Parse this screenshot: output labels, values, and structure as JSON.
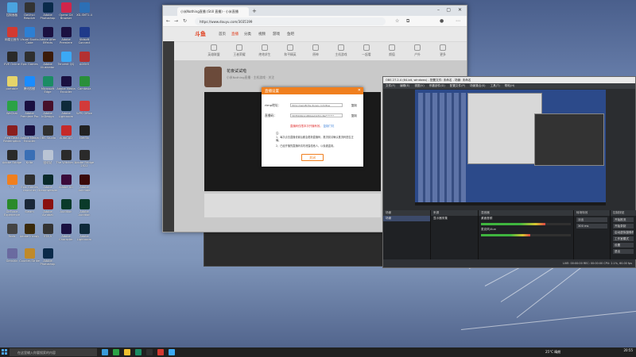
{
  "desktop": {
    "icons": [
      {
        "label": "控制面板",
        "color": "#4aa3df"
      },
      {
        "label": "DaVinci Resolve",
        "color": "#333333"
      },
      {
        "label": "Adobe Photoshop",
        "color": "#0a2a4a"
      },
      {
        "label": "Opera GX Browser",
        "color": "#d0254b"
      },
      {
        "label": "XD-SMT1.4",
        "color": "#2c6fb5"
      },
      {
        "label": "网易云音乐",
        "color": "#d33a31"
      },
      {
        "label": "Visual Studio Code",
        "color": "#2d7fd3"
      },
      {
        "label": "Adobe After Effects",
        "color": "#1a1040"
      },
      {
        "label": "Adobe Premiere",
        "color": "#1a1040"
      },
      {
        "label": "Ubisoft Connect",
        "color": "#1f3a8a"
      },
      {
        "label": "EVE Online",
        "color": "#2a2a2a"
      },
      {
        "label": "Epic Games",
        "color": "#2f2f2f"
      },
      {
        "label": "Adobe Illustrator",
        "color": "#3b1b0a"
      },
      {
        "label": "Tencent QQ",
        "color": "#3ba9f5"
      },
      {
        "label": "ADSKS",
        "color": "#b33131"
      },
      {
        "label": "portable",
        "color": "#e6d46a"
      },
      {
        "label": "腾讯视频",
        "color": "#1a8cff"
      },
      {
        "label": "Microsoft Edge",
        "color": "#1b8c64"
      },
      {
        "label": "Adobe Media Encoder",
        "color": "#1a1040"
      },
      {
        "label": "Camtasia",
        "color": "#2a8f3a"
      },
      {
        "label": "WeChat",
        "color": "#2ba245"
      },
      {
        "label": "Adobe Premiere Pro",
        "color": "#1a1040"
      },
      {
        "label": "Adobe InDesign",
        "color": "#47102a"
      },
      {
        "label": "Adobe Lightroom",
        "color": "#0e2a3a"
      },
      {
        "label": "WPS Office",
        "color": "#d23a3a"
      },
      {
        "label": "Red Dead Redemption",
        "color": "#8a1e1e"
      },
      {
        "label": "Adobe Media Encoder",
        "color": "#1a1040"
      },
      {
        "label": "OBS Studio",
        "color": "#303030"
      },
      {
        "label": "AutoCAD",
        "color": "#c52a2a"
      },
      {
        "label": "Netflix",
        "color": "#222222"
      },
      {
        "label": "Adobe Bridge",
        "color": "#2a2a2a"
      },
      {
        "label": "Krita",
        "color": "#3a6fb5"
      },
      {
        "label": "回收站",
        "color": "#b9c4d4"
      },
      {
        "label": "The Witcher 3",
        "color": "#2a2a2a"
      },
      {
        "label": "Adobe Bridge 2022",
        "color": "#2a2a2a"
      },
      {
        "label": "小米",
        "color": "#f07f1e"
      },
      {
        "label": "Epic Games Launcher",
        "color": "#2f2f2f"
      },
      {
        "label": "Adobe Dreamweaver",
        "color": "#0a2a2a"
      },
      {
        "label": "Adobe XD",
        "color": "#3a0a3a"
      },
      {
        "label": "Adobe Animate",
        "color": "#3a0a0a"
      },
      {
        "label": "GeForce Experience",
        "color": "#2a8a2a"
      },
      {
        "label": "Steam",
        "color": "#1b2838"
      },
      {
        "label": "Adobe Acrobat",
        "color": "#8a1010"
      },
      {
        "label": "Audition",
        "color": "#0a3a2a"
      },
      {
        "label": "Adobe Audition",
        "color": "#0a3a2a"
      },
      {
        "label": "Tools",
        "color": "#444444"
      },
      {
        "label": "Adobe Incopy",
        "color": "#3a2a0a"
      },
      {
        "label": "GTA V",
        "color": "#333333"
      },
      {
        "label": "Adobe Character",
        "color": "#1a1040"
      },
      {
        "label": "Adobe Lightroom Classic",
        "color": "#0e2a3a"
      },
      {
        "label": "Genshin",
        "color": "#6a6aa0"
      },
      {
        "label": "Counter-Strike",
        "color": "#c08a2a"
      },
      {
        "label": "Adobe Photoshop 2022",
        "color": "#0a2a4a"
      }
    ]
  },
  "browser": {
    "tab_title": "小米Nothing直播 (Still 直播) - 小米直播",
    "url": "https://www.douyu.com/3035199",
    "new_tab": "+",
    "site": {
      "logo": "斗鱼",
      "nav": [
        "首页",
        "直播",
        "分类",
        "视频",
        "游戏",
        "鱼吧"
      ],
      "categories": [
        "英雄联盟",
        "王者荣耀",
        "绝地求生",
        "和平精英",
        "原神",
        "主机游戏",
        "一起看",
        "颜值",
        "户外",
        "更多"
      ],
      "streamer_name": "花夜试试啦",
      "streamer_meta": "小米Nothing直播 · 主机游戏 · 关注"
    },
    "dialog": {
      "title": "直播设置",
      "rtmp_label": "rtmp地址：",
      "rtmp_value": "rtmp://sendtc3a.douyu.com/live",
      "code_label": "直播码：",
      "code_value": "3035199rgnXRKguDpTmcRe*******",
      "copy1": "复制",
      "copy2": "复制",
      "warning": "直播码仅限本次开播有效。",
      "warning_link": "复制门坑",
      "notes_title": "注：",
      "notes": [
        "1、每次点击直播设置后都会更新直播码，推流前请确认推流码是否正确。",
        "2、已经开播的直播码请勿泄露给他人，以免被盗用。"
      ],
      "close_button": "关闭"
    }
  },
  "obs": {
    "title": "OBS 27.2.4 (64-bit, windows) - 配置文件: 未命名 - 场景: 未命名",
    "menu": [
      "文件(F)",
      "编辑(E)",
      "视图(V)",
      "停靠部件(D)",
      "配置文件(P)",
      "场景集合(S)",
      "工具(T)",
      "帮助(H)"
    ],
    "docks": {
      "scenes_title": "场景",
      "scenes": [
        "场景"
      ],
      "sources_title": "来源",
      "sources": [
        "显示器采集"
      ],
      "mixer_title": "混音器",
      "mixer": [
        {
          "name": "桌面音频",
          "level": 0.72
        },
        {
          "name": "麦克风/Aux",
          "level": 0.55
        }
      ],
      "transitions_title": "转场特效",
      "transition": "淡出",
      "duration": "300 ms",
      "controls_title": "控制按钮",
      "controls": [
        "开始推流",
        "开始录制",
        "启动虚拟摄像机",
        "工作室模式",
        "设置",
        "退出"
      ]
    },
    "status": "LIVE: 00:00:00   REC: 00:00:00   CPU: 2.1%, 60.00 fps"
  },
  "taskbar": {
    "search_placeholder": "在这里输入你要搜索的内容",
    "weather": "25°C 晴朗",
    "time": "20:55",
    "date": "2022/5/4",
    "apps": [
      "#3a9ad9",
      "#2ba245",
      "#f0c030",
      "#1b8c64",
      "#303030",
      "#d33a31",
      "#3ba9f5"
    ]
  }
}
